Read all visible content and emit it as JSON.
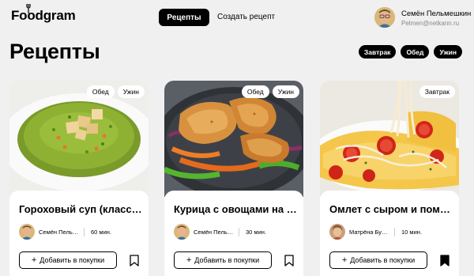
{
  "header": {
    "logo": "Foodgram",
    "nav_active": "Рецепты",
    "nav_create": "Создать рецепт",
    "user_name": "Семён Пельмешкин",
    "user_email": "Pelmen@netkann.ru"
  },
  "page": {
    "title": "Рецепты",
    "filters": [
      "Завтрак",
      "Обед",
      "Ужин"
    ]
  },
  "cards": [
    {
      "title": "Гороховый суп (классический)",
      "tags": [
        "Обед",
        "Ужин"
      ],
      "author": "Семён Пельмешкин",
      "time": "60 мин.",
      "add_label": "Добавить в покупки",
      "favorited": false
    },
    {
      "title": "Курица с овощами на сковороде",
      "tags": [
        "Обед",
        "Ужин"
      ],
      "author": "Семён Пельмешкин",
      "time": "30 мин.",
      "add_label": "Добавить в покупки",
      "favorited": false
    },
    {
      "title": "Омлет с сыром и помидорами",
      "tags": [
        "Завтрак"
      ],
      "author": "Матрёна Бурёнкина",
      "time": "10 мин.",
      "add_label": "Добавить в покупки",
      "favorited": true
    }
  ]
}
